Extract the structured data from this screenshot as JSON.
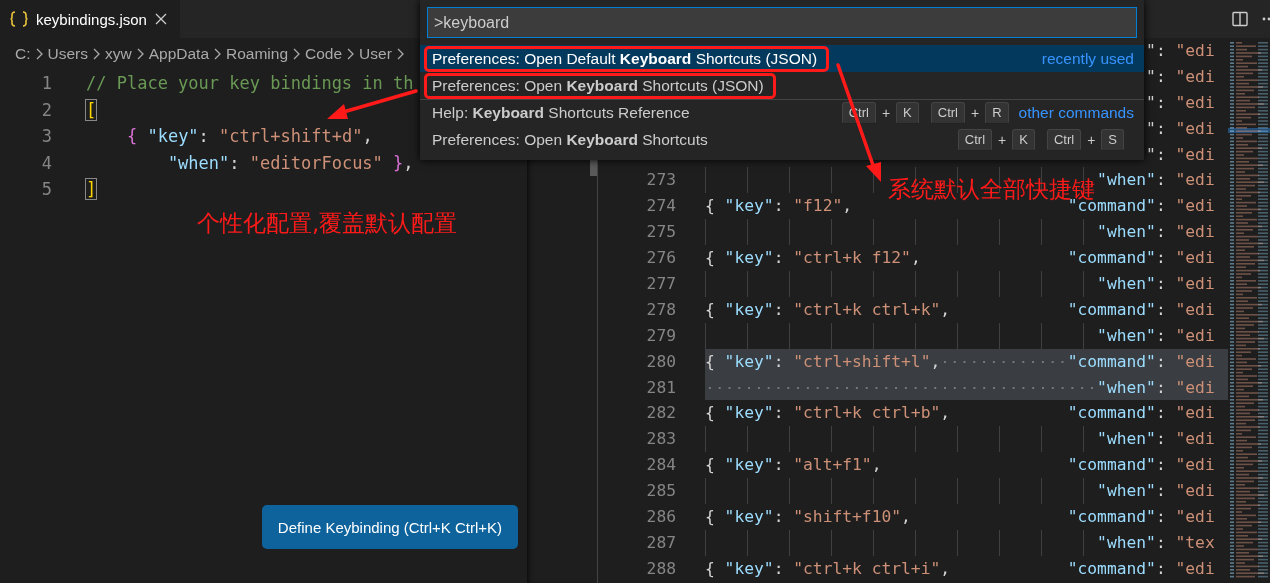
{
  "tab": {
    "label": "keybindings.json",
    "selected": true
  },
  "breadcrumb": [
    "C:",
    "Users",
    "xyw",
    "AppData",
    "Roaming",
    "Code",
    "User"
  ],
  "left_editor": {
    "lines": [
      {
        "number": "1",
        "kind": "root",
        "tokens": [
          {
            "kind": "comment",
            "text": "// Place your key bindings in th"
          }
        ]
      },
      {
        "number": "2",
        "kind": "root",
        "tokens": [
          {
            "kind": "matched_bracket",
            "text": "["
          }
        ]
      },
      {
        "number": "3",
        "kind": "member",
        "tokens": [
          {
            "kind": "brace",
            "text": "{ "
          },
          {
            "kind": "property",
            "text": "\"key\""
          },
          {
            "kind": "punct",
            "text": ": "
          },
          {
            "kind": "string",
            "text": "\"ctrl+shift+d\""
          },
          {
            "kind": "punct",
            "text": ","
          }
        ]
      },
      {
        "number": "4",
        "kind": "continuation",
        "tokens": [
          {
            "kind": "property",
            "text": "\"when\""
          },
          {
            "kind": "punct",
            "text": ": "
          },
          {
            "kind": "string",
            "text": "\"editorFocus\" "
          },
          {
            "kind": "brace",
            "text": "}"
          },
          {
            "kind": "punct",
            "text": ","
          }
        ]
      },
      {
        "number": "5",
        "kind": "root",
        "tokens": [
          {
            "kind": "matched_bracket",
            "text": "]"
          }
        ]
      }
    ],
    "button": "Define Keybinding (Ctrl+K Ctrl+K)"
  },
  "right_editor": {
    "lines": [
      {
        "kind": "tail",
        "selected": false,
        "right": [
          {
            "kind": "punct",
            "text": "\": "
          },
          {
            "kind": "string",
            "text": "\"edi"
          }
        ]
      },
      {
        "kind": "tail",
        "selected": false,
        "right": [
          {
            "kind": "punct",
            "text": "\": "
          },
          {
            "kind": "string",
            "text": "\"edi"
          }
        ]
      },
      {
        "kind": "tail",
        "selected": false,
        "right": [
          {
            "kind": "punct",
            "text": "\": "
          },
          {
            "kind": "string",
            "text": "\"edi"
          }
        ]
      },
      {
        "kind": "tail",
        "selected": false,
        "right": [
          {
            "kind": "punct",
            "text": "\": "
          },
          {
            "kind": "string",
            "text": "\"edi"
          }
        ]
      },
      {
        "kind": "tail",
        "selected": false,
        "right": [
          {
            "kind": "punct",
            "text": "\": "
          },
          {
            "kind": "string",
            "text": "\"edi"
          }
        ]
      },
      {
        "number": "273",
        "kind": "when",
        "selected": false,
        "right": [
          {
            "kind": "property",
            "text": "\"when\""
          },
          {
            "kind": "punct",
            "text": ": "
          },
          {
            "kind": "string",
            "text": "\"edi"
          }
        ]
      },
      {
        "number": "274",
        "kind": "key",
        "selected": false,
        "left": [
          {
            "kind": "punct",
            "text": "{ "
          },
          {
            "kind": "property",
            "text": "\"key\""
          },
          {
            "kind": "punct",
            "text": ": "
          },
          {
            "kind": "string",
            "text": "\"f12\""
          },
          {
            "kind": "punct",
            "text": ","
          }
        ],
        "right": [
          {
            "kind": "property",
            "text": "\"command\""
          },
          {
            "kind": "punct",
            "text": ": "
          },
          {
            "kind": "string",
            "text": "\"edi"
          }
        ]
      },
      {
        "number": "275",
        "kind": "when",
        "selected": false,
        "right": [
          {
            "kind": "property",
            "text": "\"when\""
          },
          {
            "kind": "punct",
            "text": ": "
          },
          {
            "kind": "string",
            "text": "\"edi"
          }
        ]
      },
      {
        "number": "276",
        "kind": "key",
        "selected": false,
        "left": [
          {
            "kind": "punct",
            "text": "{ "
          },
          {
            "kind": "property",
            "text": "\"key\""
          },
          {
            "kind": "punct",
            "text": ": "
          },
          {
            "kind": "string",
            "text": "\"ctrl+k f12\""
          },
          {
            "kind": "punct",
            "text": ","
          }
        ],
        "right": [
          {
            "kind": "property",
            "text": "\"command\""
          },
          {
            "kind": "punct",
            "text": ": "
          },
          {
            "kind": "string",
            "text": "\"edi"
          }
        ]
      },
      {
        "number": "277",
        "kind": "when",
        "selected": false,
        "right": [
          {
            "kind": "property",
            "text": "\"when\""
          },
          {
            "kind": "punct",
            "text": ": "
          },
          {
            "kind": "string",
            "text": "\"edi"
          }
        ]
      },
      {
        "number": "278",
        "kind": "key",
        "selected": false,
        "left": [
          {
            "kind": "punct",
            "text": "{ "
          },
          {
            "kind": "property",
            "text": "\"key\""
          },
          {
            "kind": "punct",
            "text": ": "
          },
          {
            "kind": "string",
            "text": "\"ctrl+k ctrl+k\""
          },
          {
            "kind": "punct",
            "text": ","
          }
        ],
        "right": [
          {
            "kind": "property",
            "text": "\"command\""
          },
          {
            "kind": "punct",
            "text": ": "
          },
          {
            "kind": "string",
            "text": "\"edi"
          }
        ]
      },
      {
        "number": "279",
        "kind": "when",
        "selected": false,
        "right": [
          {
            "kind": "property",
            "text": "\"when\""
          },
          {
            "kind": "punct",
            "text": ": "
          },
          {
            "kind": "string",
            "text": "\"edi"
          }
        ]
      },
      {
        "number": "280",
        "kind": "key",
        "selected": true,
        "left": [
          {
            "kind": "punct",
            "text": "{ "
          },
          {
            "kind": "property",
            "text": "\"key\""
          },
          {
            "kind": "punct",
            "text": ": "
          },
          {
            "kind": "string",
            "text": "\"ctrl+shift+l\""
          },
          {
            "kind": "punct",
            "text": ","
          }
        ],
        "right": [
          {
            "kind": "property",
            "text": "\"command\""
          },
          {
            "kind": "punct",
            "text": ": "
          },
          {
            "kind": "string",
            "text": "\"edi"
          }
        ]
      },
      {
        "number": "281",
        "kind": "when",
        "selected": true,
        "right": [
          {
            "kind": "property",
            "text": "\"when\""
          },
          {
            "kind": "punct",
            "text": ": "
          },
          {
            "kind": "string",
            "text": "\"edi"
          }
        ]
      },
      {
        "number": "282",
        "kind": "key",
        "selected": false,
        "left": [
          {
            "kind": "punct",
            "text": "{ "
          },
          {
            "kind": "property",
            "text": "\"key\""
          },
          {
            "kind": "punct",
            "text": ": "
          },
          {
            "kind": "string",
            "text": "\"ctrl+k ctrl+b\""
          },
          {
            "kind": "punct",
            "text": ","
          }
        ],
        "right": [
          {
            "kind": "property",
            "text": "\"command\""
          },
          {
            "kind": "punct",
            "text": ": "
          },
          {
            "kind": "string",
            "text": "\"edi"
          }
        ]
      },
      {
        "number": "283",
        "kind": "when",
        "selected": false,
        "right": [
          {
            "kind": "property",
            "text": "\"when\""
          },
          {
            "kind": "punct",
            "text": ": "
          },
          {
            "kind": "string",
            "text": "\"edi"
          }
        ]
      },
      {
        "number": "284",
        "kind": "key",
        "selected": false,
        "left": [
          {
            "kind": "punct",
            "text": "{ "
          },
          {
            "kind": "property",
            "text": "\"key\""
          },
          {
            "kind": "punct",
            "text": ": "
          },
          {
            "kind": "string",
            "text": "\"alt+f1\""
          },
          {
            "kind": "punct",
            "text": ","
          }
        ],
        "right": [
          {
            "kind": "property",
            "text": "\"command\""
          },
          {
            "kind": "punct",
            "text": ": "
          },
          {
            "kind": "string",
            "text": "\"edi"
          }
        ]
      },
      {
        "number": "285",
        "kind": "when",
        "selected": false,
        "right": [
          {
            "kind": "property",
            "text": "\"when\""
          },
          {
            "kind": "punct",
            "text": ": "
          },
          {
            "kind": "string",
            "text": "\"edi"
          }
        ]
      },
      {
        "number": "286",
        "kind": "key",
        "selected": false,
        "left": [
          {
            "kind": "punct",
            "text": "{ "
          },
          {
            "kind": "property",
            "text": "\"key\""
          },
          {
            "kind": "punct",
            "text": ": "
          },
          {
            "kind": "string",
            "text": "\"shift+f10\""
          },
          {
            "kind": "punct",
            "text": ","
          }
        ],
        "right": [
          {
            "kind": "property",
            "text": "\"command\""
          },
          {
            "kind": "punct",
            "text": ": "
          },
          {
            "kind": "string",
            "text": "\"edi"
          }
        ]
      },
      {
        "number": "287",
        "kind": "when",
        "selected": false,
        "right": [
          {
            "kind": "property",
            "text": "\"when\""
          },
          {
            "kind": "punct",
            "text": ": "
          },
          {
            "kind": "string",
            "text": "\"tex"
          }
        ]
      },
      {
        "number": "288",
        "kind": "key",
        "selected": false,
        "left": [
          {
            "kind": "punct",
            "text": "{ "
          },
          {
            "kind": "property",
            "text": "\"key\""
          },
          {
            "kind": "punct",
            "text": ": "
          },
          {
            "kind": "string",
            "text": "\"ctrl+k ctrl+i\""
          },
          {
            "kind": "punct",
            "text": ","
          }
        ],
        "right": [
          {
            "kind": "property",
            "text": "\"command\""
          },
          {
            "kind": "punct",
            "text": ": "
          },
          {
            "kind": "string",
            "text": "\"edi"
          }
        ]
      }
    ]
  },
  "command_palette": {
    "value": ">keyboard",
    "items": [
      {
        "label": "Preferences: Open Default **Keyboard** Shortcuts (JSON)",
        "selected": true,
        "separator": false,
        "circled": true,
        "detail": "recently used"
      },
      {
        "label": "Preferences: Open **Keyboard** Shortcuts (JSON)",
        "selected": false,
        "separator": false,
        "circled": true
      },
      {
        "label": "Help: **Keyboard** Shortcuts Reference",
        "selected": false,
        "separator": true,
        "circled": false,
        "keys": [
          [
            "Ctrl",
            "+",
            "K"
          ],
          [
            "Ctrl",
            "+",
            "R"
          ]
        ],
        "detail": "other commands"
      },
      {
        "label": "Preferences: Open **Keyboard** Shortcuts",
        "selected": false,
        "separator": false,
        "circled": false,
        "keys": [
          [
            "Ctrl",
            "+",
            "K"
          ],
          [
            "Ctrl",
            "+",
            "S"
          ]
        ]
      }
    ]
  },
  "annotations": [
    "个性化配置,覆盖默认配置",
    "系统默认全部快捷键"
  ]
}
